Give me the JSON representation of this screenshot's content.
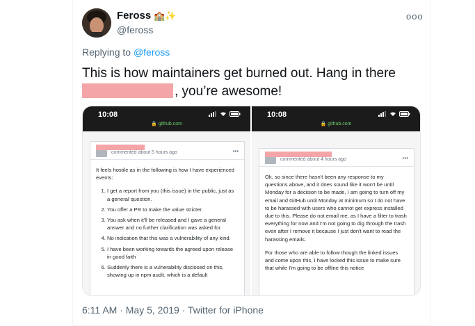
{
  "author": {
    "name": "Feross",
    "handle": "@feross",
    "emoji": "🏫✨"
  },
  "replying": {
    "prefix": "Replying to ",
    "handle": "@feross"
  },
  "tweet": {
    "line1": "This is how maintainers get burned out. Hang in there",
    "line2_suffix": ", you’re awesome!"
  },
  "screenshots": {
    "left": {
      "time": "10:08",
      "url": "🔒 github.com",
      "meta": "commented about 5 hours ago",
      "intro": "It feels hostile as in the following is how I have experienced events:",
      "items": [
        "I get a report from you (this issue) in the public, just as a general question.",
        "You offer a PR to make the value stricter.",
        "You ask when it'll be released and I gave a general answer and no further clarification was asked for.",
        "No indication that this was a vulnerability of any kind.",
        "I have been working towards the agreed upon release in good faith",
        "Suddenly there is a vulnerability disclosed on this, showing up in npm audit, which is a default"
      ]
    },
    "right": {
      "time": "10:08",
      "url": "🔒 github.com",
      "meta": "commented about 4 hours ago",
      "p1": "Ok, so since there hasn't been any response to my questions above, and it does sound like it won't be until Monday for a decision to be made, I am going to turn off my email and GitHub until Monday at minimum so I do not have to be harassed with users who cannot get express installed due to this. Please do not email me, as I have a filter to trash everything for now and I'm not going to dig through the trash even after I remove it because I just don't want to read the harassing emails.",
      "p2": "For those who are able to follow though the linked issues and come upon this, I have locked this issue to make sure that while I'm going to be offline this notice"
    }
  },
  "footer": {
    "text": "6:11 AM · May 5, 2019 · Twitter for iPhone"
  },
  "colors": {
    "accent": "#1d9bf0",
    "redaction": "#f3a5a8",
    "muted": "#536471"
  }
}
